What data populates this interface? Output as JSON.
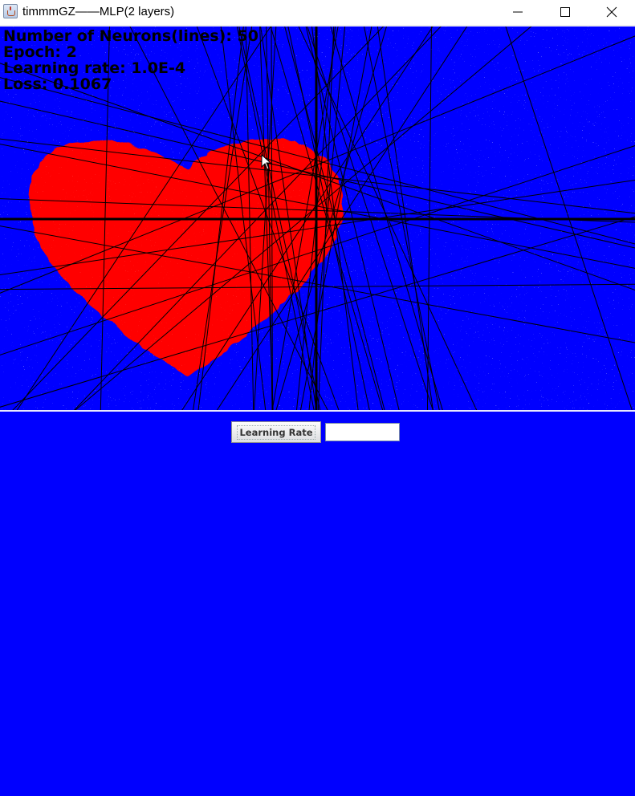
{
  "window": {
    "title": "timmmGZ——MLP(2 layers)",
    "icon": "java-app-icon"
  },
  "hud": {
    "neurons": "Number of Neurons(lines): 50",
    "epoch": "Epoch: 2",
    "learning_rate": "Learning rate: 1.0E-4",
    "loss": "Loss: 0.1067"
  },
  "controls": {
    "learning_rate_button": "Learning Rate",
    "learning_rate_value": "",
    "learning_rate_placeholder": ""
  },
  "colors": {
    "background_class": "#0000ff",
    "heart_class": "#ff0000",
    "neuron_lines": "#000000",
    "axes": "#000000"
  },
  "visual": {
    "decision_region_shape": "heart",
    "neuron_line_count": 50
  }
}
